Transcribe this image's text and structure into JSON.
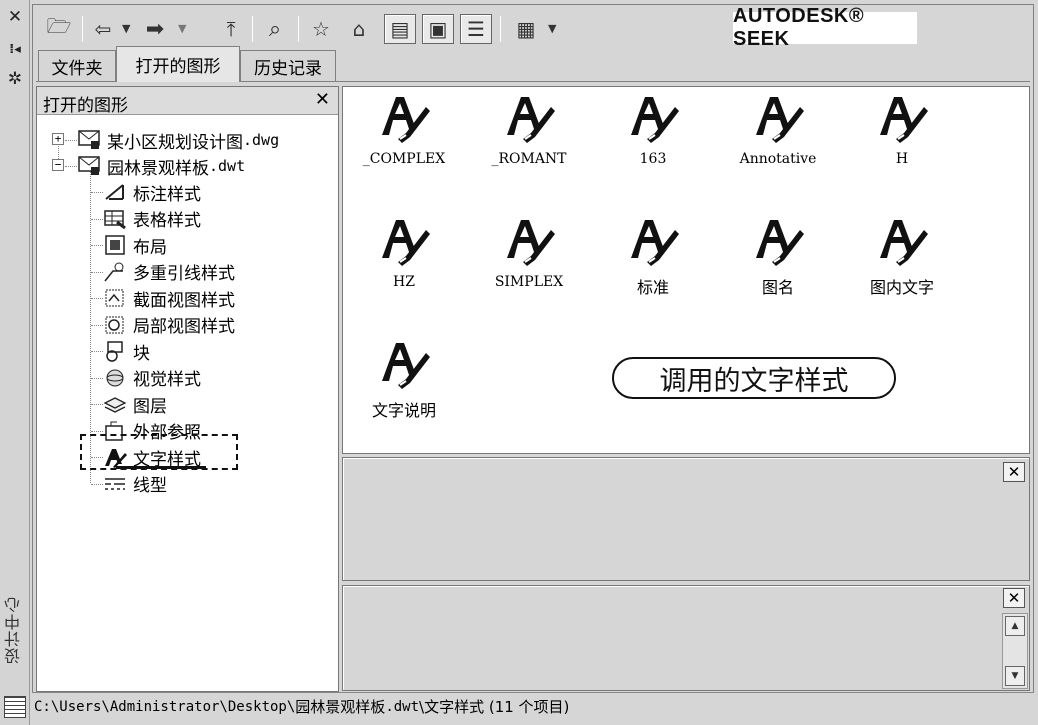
{
  "strip": {
    "close_glyph": "✕",
    "pin_glyph": "⁞◂",
    "props_glyph": "✲",
    "title": "设计中心"
  },
  "toolbar": {
    "buttons": [
      {
        "name": "load-icon",
        "glyph": "🗁"
      },
      {
        "name": "back-icon",
        "glyph": "⇦"
      },
      {
        "name": "forward-icon",
        "glyph": "➡"
      },
      {
        "name": "up-icon",
        "glyph": "⤒"
      },
      {
        "name": "search-icon",
        "glyph": "⌕"
      },
      {
        "name": "favorites-icon",
        "glyph": "☆"
      },
      {
        "name": "home-icon",
        "glyph": "⌂"
      },
      {
        "name": "tree-toggle-icon",
        "glyph": "▤"
      },
      {
        "name": "preview-icon",
        "glyph": "▣"
      },
      {
        "name": "description-icon",
        "glyph": "☰"
      },
      {
        "name": "views-icon",
        "glyph": "▦"
      }
    ],
    "seek_label": "AUTODESK® SEEK"
  },
  "tabs": [
    {
      "label": "文件夹"
    },
    {
      "label": "打开的图形"
    },
    {
      "label": "历史记录"
    }
  ],
  "tree": {
    "title": "打开的图形",
    "close_glyph": "✕",
    "drawings": [
      {
        "name": "某小区规划设计图",
        "ext": ".dwg",
        "expander": "+"
      },
      {
        "name": "园林景观样板",
        "ext": ".dwt",
        "expander": "−"
      }
    ],
    "children": [
      "标注样式",
      "表格样式",
      "布局",
      "多重引线样式",
      "截面视图样式",
      "局部视图样式",
      "块",
      "视觉样式",
      "图层",
      "外部参照",
      "文字样式",
      "线型"
    ]
  },
  "styles": [
    "_COMPLEX",
    "_ROMANT",
    "163",
    "Annotative",
    "H",
    "HZ",
    "SIMPLEX",
    "标准",
    "图名",
    "图内文字",
    "文字说明"
  ],
  "callout": "调用的文字样式",
  "panes": {
    "close_glyph": "✕",
    "scroll_up": "▲",
    "scroll_down": "▼"
  },
  "status": {
    "path": "C:\\Users\\Administrator\\Desktop\\",
    "file": "园林景观样板",
    "ext": ".dwt",
    "rest": "\\文字样式 (11 个项目)"
  }
}
